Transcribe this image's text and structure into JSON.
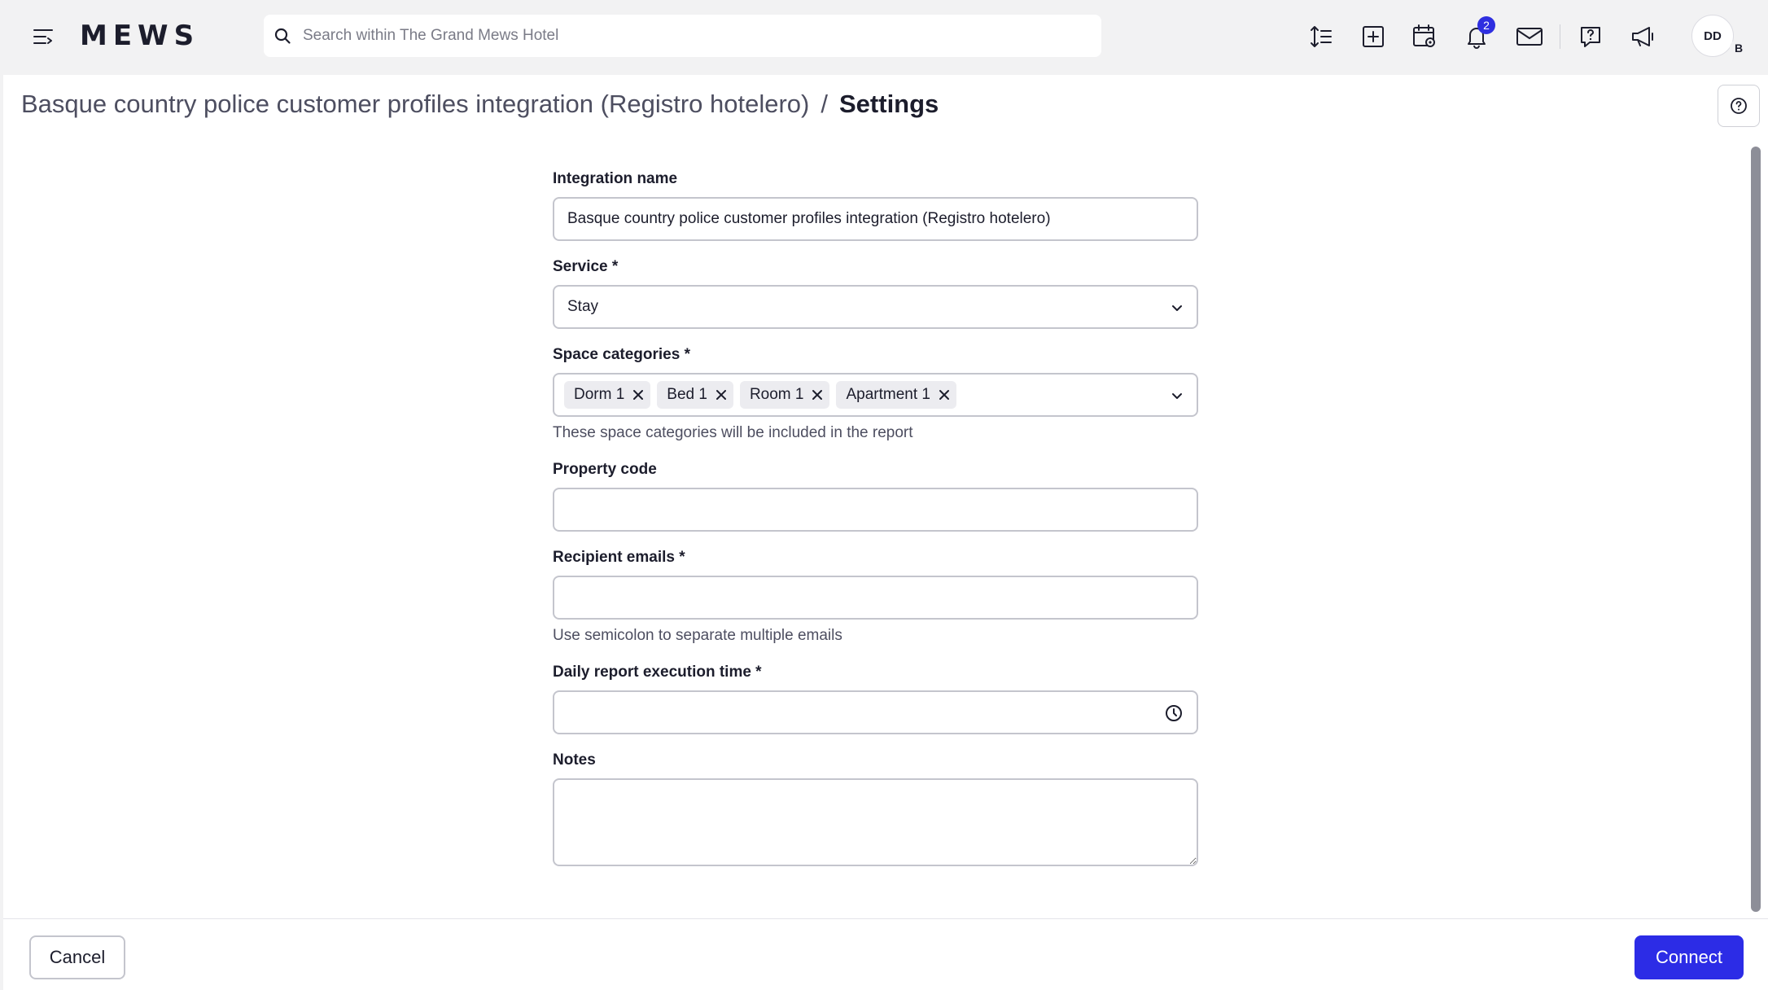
{
  "app": {
    "logo": "MEWS"
  },
  "search": {
    "placeholder": "Search within The Grand Mews Hotel"
  },
  "toolbar": {
    "icons": [
      "line-height-icon",
      "add-icon",
      "calendar-icon",
      "bell-icon",
      "mail-icon",
      "help-chat-icon",
      "megaphone-icon"
    ],
    "notifications_count": "2"
  },
  "user": {
    "initials": "DD",
    "property_initial": "B"
  },
  "header": {
    "breadcrumb_parent": "Basque country police customer profiles integration (Registro hotelero)",
    "separator": "/",
    "current": "Settings"
  },
  "form": {
    "integration_name": {
      "label": "Integration name",
      "value": "Basque country police customer profiles integration (Registro hotelero)"
    },
    "service": {
      "label": "Service *",
      "value": "Stay"
    },
    "space_categories": {
      "label": "Space categories *",
      "chips": [
        "Dorm 1",
        "Bed 1",
        "Room 1",
        "Apartment 1"
      ],
      "hint": "These space categories will be included in the report"
    },
    "property_code": {
      "label": "Property code",
      "value": ""
    },
    "recipient_emails": {
      "label": "Recipient emails *",
      "value": "",
      "hint": "Use semicolon to separate multiple emails"
    },
    "daily_report_time": {
      "label": "Daily report execution time *",
      "value": ""
    },
    "notes": {
      "label": "Notes",
      "value": ""
    }
  },
  "footer": {
    "cancel_label": "Cancel",
    "connect_label": "Connect"
  },
  "colors": {
    "accent": "#2c2ce6",
    "badge": "#2f2fe0",
    "background": "#f2f2f3"
  }
}
